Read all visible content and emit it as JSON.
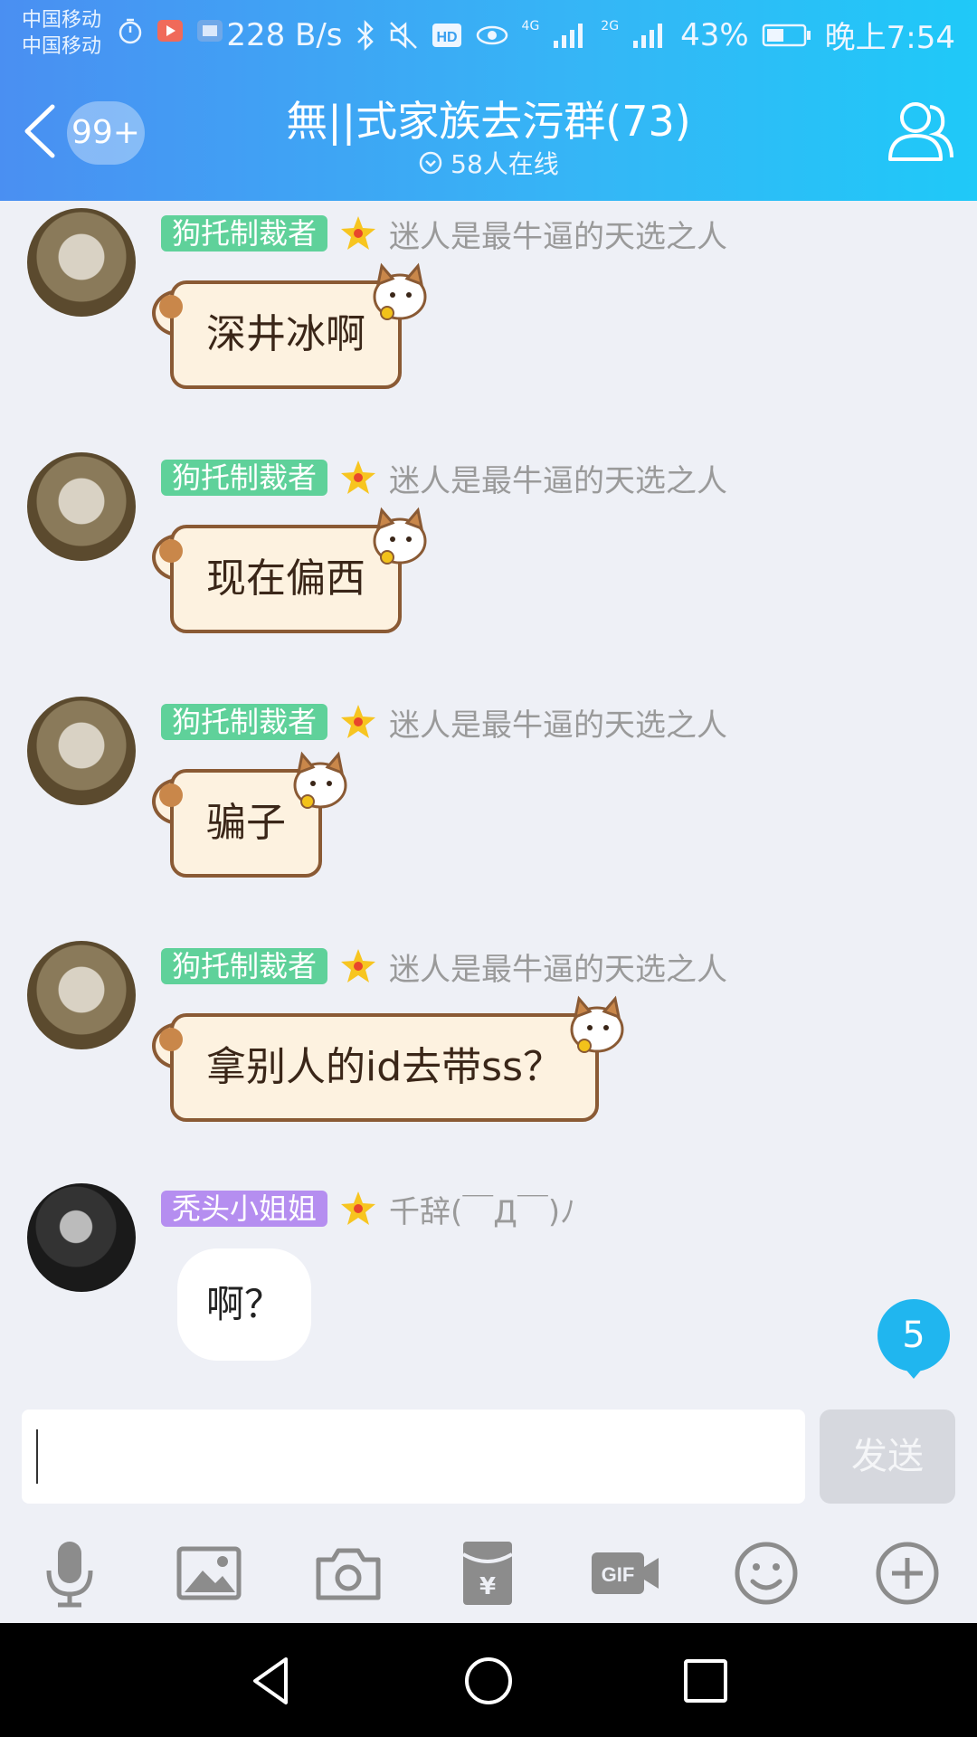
{
  "status_bar": {
    "carrier1": "中国移动",
    "carrier2": "中国移动",
    "net_speed": "228 B/s",
    "signal1": "4G",
    "signal2": "2G",
    "battery": "43%",
    "time": "晚上7:54"
  },
  "header": {
    "unread_badge": "99+",
    "title": "無||式家族去污群(73)",
    "online": "58人在线"
  },
  "messages": [
    {
      "tag": "狗托制裁者",
      "nick": "迷人是最牛逼的天选之人",
      "text": "深井冰啊"
    },
    {
      "tag": "狗托制裁者",
      "nick": "迷人是最牛逼的天选之人",
      "text": "现在偏西"
    },
    {
      "tag": "狗托制裁者",
      "nick": "迷人是最牛逼的天选之人",
      "text": "骗子"
    },
    {
      "tag": "狗托制裁者",
      "nick": "迷人是最牛逼的天选之人",
      "text": "拿别人的id去带ss？"
    },
    {
      "tag": "秃头小姐姐",
      "nick": "千辞(￣Д￣)ﾉ",
      "text": "啊？"
    }
  ],
  "new_messages_count": "5",
  "input": {
    "value": "",
    "send_label": "发送"
  },
  "colors": {
    "header_start": "#4a8ff2",
    "header_end": "#1fc9f8",
    "tag_green": "#5fd19a",
    "tag_purple": "#b58ef0",
    "badge_blue": "#20b6ef"
  },
  "toolbar_icons": [
    "microphone-icon",
    "image-icon",
    "camera-icon",
    "red-packet-icon",
    "gif-icon",
    "emoji-icon",
    "plus-icon"
  ]
}
